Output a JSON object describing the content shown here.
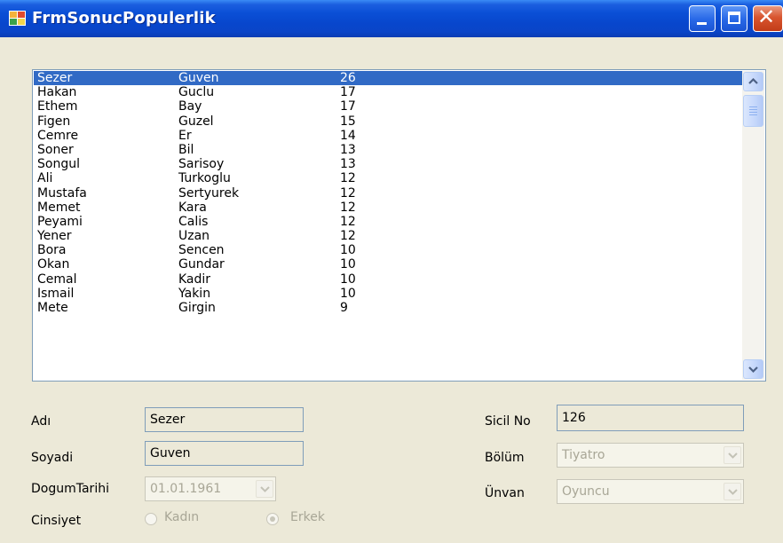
{
  "window": {
    "title": "FrmSonucPopulerlik",
    "icons": {
      "app": "app-icon",
      "minimize": "minimize-icon",
      "maximize": "maximize-icon",
      "close": "close-icon"
    },
    "title_gradient": [
      "#3a8cf5",
      "#0846cc"
    ],
    "close_color": "#d8552f"
  },
  "list": {
    "selected_color": "#316ac5",
    "rows": [
      {
        "first": "Sezer",
        "last": "Guven",
        "score": "26",
        "selected": true
      },
      {
        "first": "Hakan",
        "last": "Guclu",
        "score": "17"
      },
      {
        "first": "Ethem",
        "last": "Bay",
        "score": "17"
      },
      {
        "first": "Figen",
        "last": "Guzel",
        "score": "15"
      },
      {
        "first": "Cemre",
        "last": "Er",
        "score": "14"
      },
      {
        "first": "Soner",
        "last": "Bil",
        "score": "13"
      },
      {
        "first": "Songul",
        "last": "Sarisoy",
        "score": "13"
      },
      {
        "first": "Ali",
        "last": "Turkoglu",
        "score": "12"
      },
      {
        "first": "Mustafa",
        "last": "Sertyurek",
        "score": "12"
      },
      {
        "first": "Memet",
        "last": "Kara",
        "score": "12"
      },
      {
        "first": "Peyami",
        "last": "Calis",
        "score": "12"
      },
      {
        "first": "Yener",
        "last": "Uzan",
        "score": "12"
      },
      {
        "first": "Bora",
        "last": "Sencen",
        "score": "10"
      },
      {
        "first": "Okan",
        "last": "Gundar",
        "score": "10"
      },
      {
        "first": "Cemal",
        "last": "Kadir",
        "score": "10"
      },
      {
        "first": "Ismail",
        "last": "Yakin",
        "score": "10"
      },
      {
        "first": "Mete",
        "last": "Girgin",
        "score": "9"
      }
    ],
    "scroll_icons": {
      "up": "scroll-up-arrow-icon",
      "down": "scroll-down-arrow-icon"
    }
  },
  "form": {
    "adi_label": "Adı",
    "adi_value": "Sezer",
    "soyadi_label": "Soyadi",
    "soyadi_value": "Guven",
    "dogum_label": "DogumTarihi",
    "dogum_value": "01.01.1961",
    "cinsiyet_label": "Cinsiyet",
    "kadin_label": "Kadın",
    "erkek_label": "Erkek",
    "erkek_selected": true,
    "sicil_label": "Sicil No",
    "sicil_value": "126",
    "bolum_label": "Bölüm",
    "bolum_value": "Tiyatro",
    "unvan_label": "Ünvan",
    "unvan_value": "Oyuncu"
  }
}
